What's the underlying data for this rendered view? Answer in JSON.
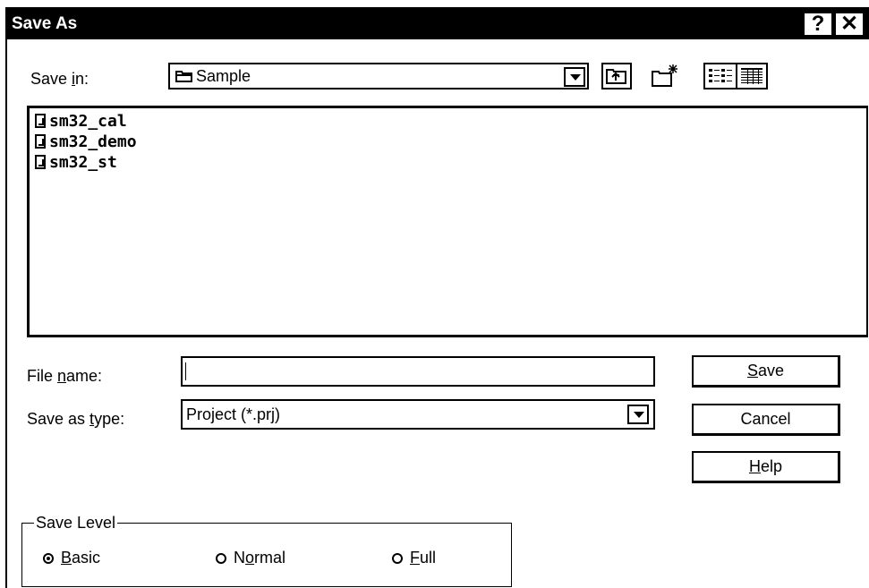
{
  "window": {
    "title": "Save As",
    "help_button": "?",
    "close_button": "✕"
  },
  "save_in": {
    "label_pre": "Save ",
    "label_accel": "i",
    "label_post": "n:",
    "value": "Sample"
  },
  "toolbar": {
    "up_icon": "folder-up-icon",
    "new_folder_icon": "new-folder-icon",
    "list_view_icon": "list-view-icon",
    "details_view_icon": "details-view-icon"
  },
  "files": [
    {
      "name": "sm32_cal"
    },
    {
      "name": "sm32_demo"
    },
    {
      "name": "sm32_st"
    }
  ],
  "file_name": {
    "label_pre": "File ",
    "label_accel": "n",
    "label_post": "ame:",
    "value": ""
  },
  "save_as_type": {
    "label_pre": "Save as ",
    "label_accel": "t",
    "label_post": "ype:",
    "value": "Project (*.prj)"
  },
  "buttons": {
    "save": {
      "accel": "S",
      "rest": "ave"
    },
    "cancel": {
      "label": "Cancel"
    },
    "help": {
      "accel": "H",
      "rest": "elp"
    }
  },
  "save_level": {
    "title": "Save Level",
    "options": [
      {
        "accel": "B",
        "rest": "asic",
        "checked": true
      },
      {
        "pre": "N",
        "accel": "o",
        "rest": "rmal",
        "checked": false
      },
      {
        "accel": "F",
        "rest": "ull",
        "checked": false
      }
    ]
  }
}
